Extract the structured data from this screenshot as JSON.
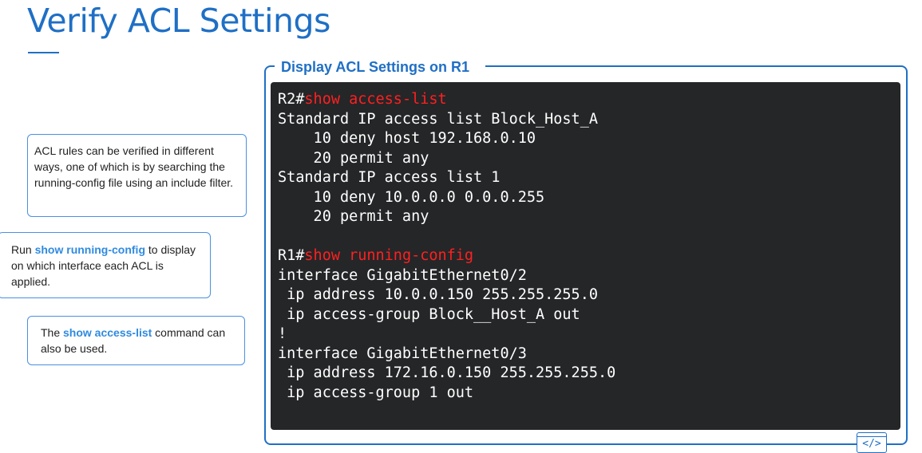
{
  "title": "Verify ACL Settings",
  "notes": [
    {
      "segments": [
        {
          "text": "ACL rules can be verified in different ways, one of which is by searching the running-config file using an include filter.",
          "highlight": false
        }
      ]
    },
    {
      "segments": [
        {
          "text": "Run ",
          "highlight": false
        },
        {
          "text": "show running-config",
          "highlight": true
        },
        {
          "text": " to display on which interface each ACL is applied.",
          "highlight": false
        }
      ]
    },
    {
      "segments": [
        {
          "text": "The ",
          "highlight": false
        },
        {
          "text": "show access-list",
          "highlight": true
        },
        {
          "text": " command can also be used.",
          "highlight": false
        }
      ]
    }
  ],
  "panel": {
    "label": "Display ACL Settings on R1",
    "lines": [
      {
        "prompt": "R2#",
        "cmd": "show access-list"
      },
      {
        "text": "Standard IP access list Block_Host_A"
      },
      {
        "text": "    10 deny host 192.168.0.10"
      },
      {
        "text": "    20 permit any"
      },
      {
        "text": "Standard IP access list 1"
      },
      {
        "text": "    10 deny 10.0.0.0 0.0.0.255"
      },
      {
        "text": "    20 permit any"
      },
      {
        "text": ""
      },
      {
        "prompt": "R1#",
        "cmd": "show running-config"
      },
      {
        "text": "interface GigabitEthernet0/2"
      },
      {
        "text": " ip address 10.0.0.150 255.255.255.0"
      },
      {
        "text": " ip access-group Block__Host_A out"
      },
      {
        "text": "!"
      },
      {
        "text": "interface GigabitEthernet0/3"
      },
      {
        "text": " ip address 172.16.0.150 255.255.255.0"
      },
      {
        "text": " ip access-group 1 out"
      }
    ]
  },
  "icons": {
    "code_icon": "code-window-icon",
    "code_glyph": "</>"
  },
  "colors": {
    "accent": "#1f6fc5",
    "highlight": "#2f8ae0",
    "command": "#ff2020",
    "terminal_bg": "#252628"
  }
}
